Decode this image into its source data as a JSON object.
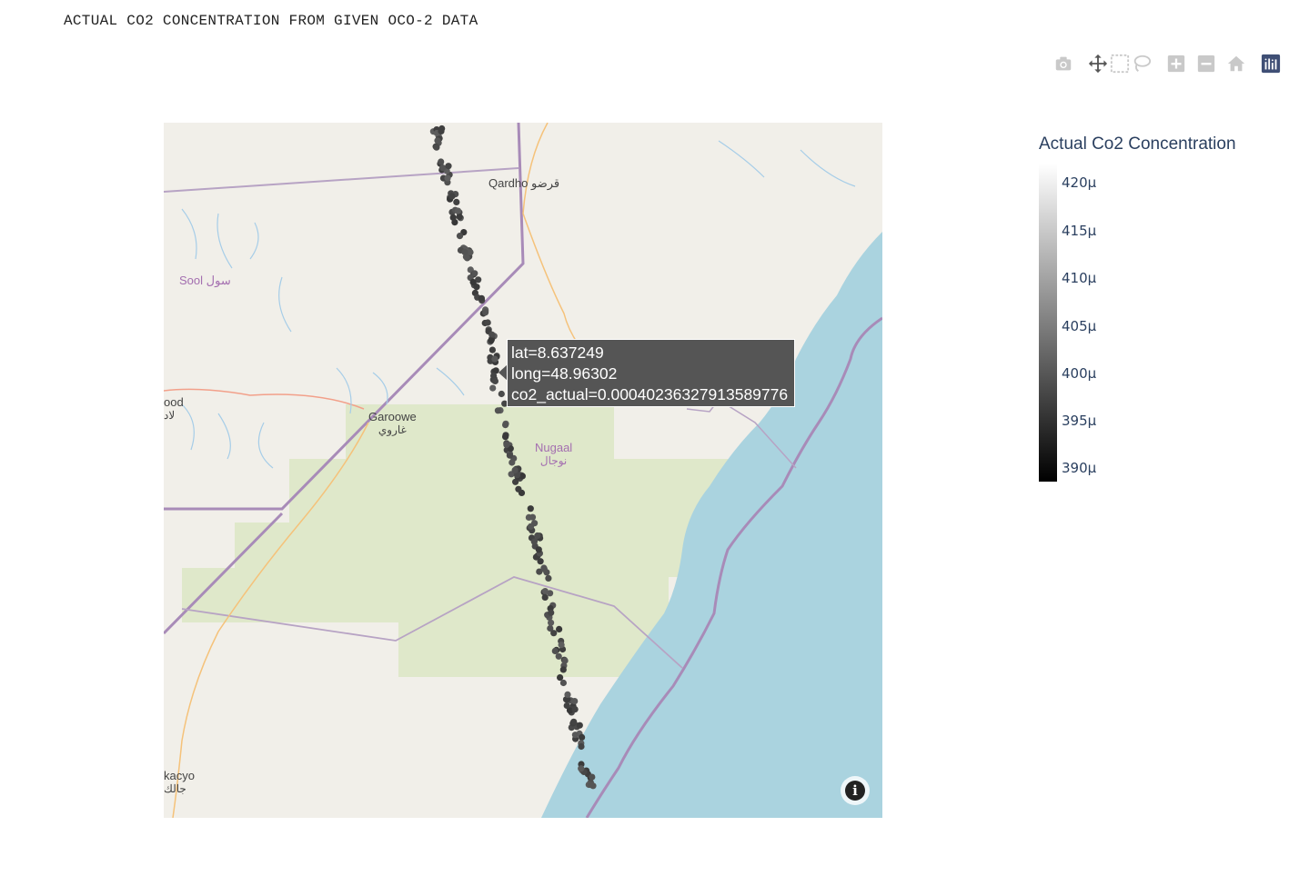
{
  "title": "ACTUAL CO2 CONCENTRATION FROM GIVEN OCO-2 DATA",
  "modebar": [
    "camera-icon",
    "pan-icon",
    "box-select-icon",
    "lasso-icon",
    "zoom-in-icon",
    "zoom-out-icon",
    "home-icon",
    "plotly-logo-icon"
  ],
  "colors": {
    "land": "#f1efe9",
    "sea": "#aad3df",
    "vegetation": "#dce6c4",
    "boundary": "#a88bb8",
    "road": "#f5c27a",
    "river": "#a6cde8",
    "tooltip_bg": "#555555",
    "axis_text": "#2a3f5f"
  },
  "map": {
    "places": [
      {
        "name": "Qardho",
        "arabic": "قرضو"
      },
      {
        "name": "Sool",
        "arabic": "سول"
      },
      {
        "name": "Garoowe",
        "arabic": "غاروي"
      },
      {
        "name": "Nugaal",
        "arabic": "نوجال"
      },
      {
        "name": "ood",
        "arabic": "لاد"
      },
      {
        "name": "kacyo",
        "arabic": "جالك"
      }
    ],
    "info_glyph": "i"
  },
  "tooltip": {
    "lat": "lat=8.637249",
    "long": "long=48.96302",
    "co2": "co2_actual=0.00040236327913589776"
  },
  "colorbar": {
    "title": "Actual Co2 Concentration",
    "ticks": [
      "420μ",
      "415μ",
      "410μ",
      "405μ",
      "400μ",
      "395μ",
      "390μ"
    ],
    "range": [
      0.000388,
      0.000423
    ],
    "colorscale": [
      "#000000",
      "#ffffff"
    ]
  }
}
